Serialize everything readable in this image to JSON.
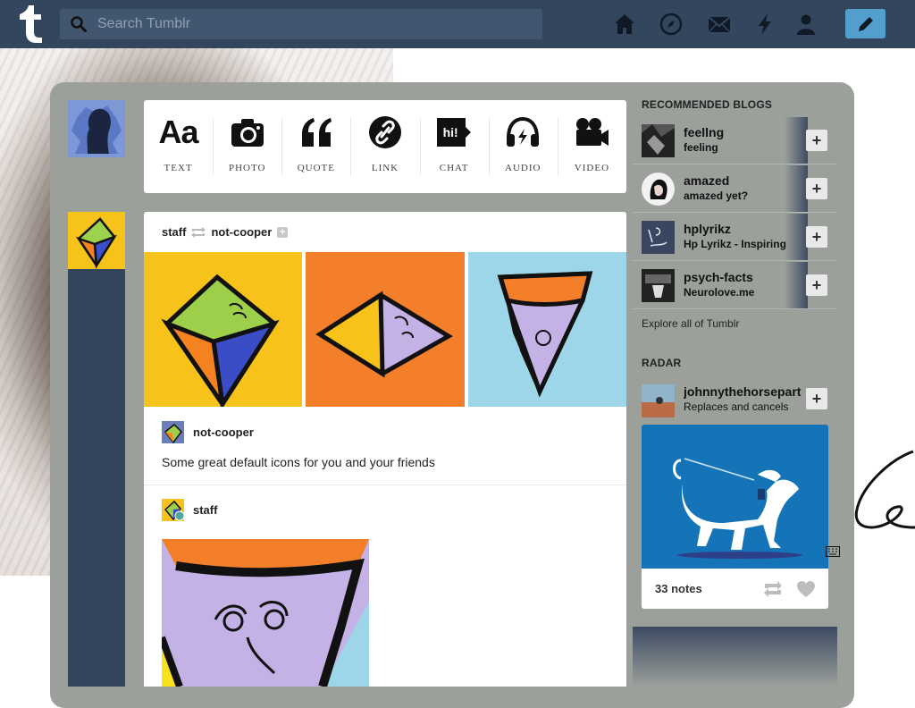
{
  "search": {
    "placeholder": "Search Tumblr"
  },
  "nav": {
    "icons": [
      "home-icon",
      "compass-icon",
      "mail-icon",
      "lightning-icon",
      "person-icon",
      "pencil-icon"
    ]
  },
  "post_types": [
    {
      "label": "TEXT",
      "glyph": "Aa"
    },
    {
      "label": "PHOTO",
      "icon": "camera-icon"
    },
    {
      "label": "QUOTE",
      "glyph": "“"
    },
    {
      "label": "LINK",
      "icon": "link-icon"
    },
    {
      "label": "CHAT",
      "glyph": "hi!"
    },
    {
      "label": "AUDIO",
      "icon": "headphones-icon"
    },
    {
      "label": "VIDEO",
      "icon": "video-camera-icon"
    }
  ],
  "post": {
    "author": "staff",
    "reblogged_from": "not-cooper",
    "reblog_name": "not-cooper",
    "caption": "Some great default icons for you and your friends",
    "original_author": "staff"
  },
  "sidebar": {
    "recommended_title": "RECOMMENDED BLOGS",
    "blogs": [
      {
        "name": "feellng",
        "sub": "feeling"
      },
      {
        "name": "amazed",
        "sub": "amazed yet?"
      },
      {
        "name": "hplyrikz",
        "sub": "Hp Lyrikz - Inspiring"
      },
      {
        "name": "psych-facts",
        "sub": "Neurolove.me"
      }
    ],
    "follow_label": "+",
    "explore": "Explore all of Tumblr",
    "radar_title": "RADAR",
    "radar": {
      "name": "johnnythehorsepart",
      "sub": "Replaces and cancels",
      "notes": "33 notes"
    }
  },
  "colors": {
    "nav": "#34465d",
    "accent": "#529ecc",
    "panel": "#9ba09b"
  }
}
